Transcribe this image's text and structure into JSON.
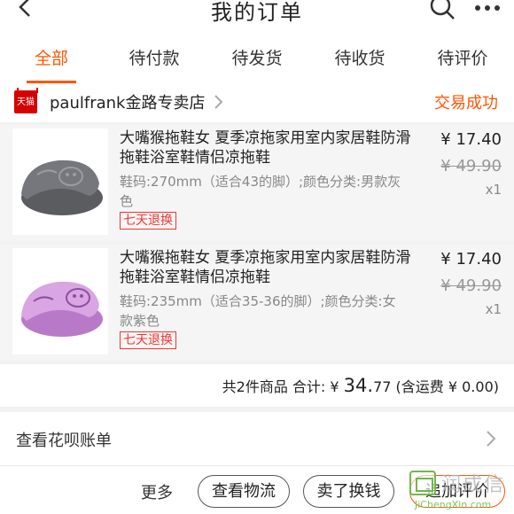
{
  "header": {
    "title": "我的订单",
    "back_icon": "chevron-left-icon",
    "search_icon": "search-icon",
    "more_icon": "more-dots-icon"
  },
  "tabs": [
    {
      "label": "全部",
      "active": true
    },
    {
      "label": "待付款",
      "active": false
    },
    {
      "label": "待发货",
      "active": false
    },
    {
      "label": "待收货",
      "active": false
    },
    {
      "label": "待评价",
      "active": false
    }
  ],
  "shop": {
    "badge": "天猫",
    "name": "paulfrank金路专卖店",
    "status": "交易成功"
  },
  "items": [
    {
      "title": "大嘴猴拖鞋女 夏季凉拖家用室内家居鞋防滑拖鞋浴室鞋情侣凉拖鞋",
      "sku": "鞋码:270mm（适合43的脚）;颜色分类:男款灰色",
      "tag": "七天退换",
      "price": "¥ 17.40",
      "original_price": "¥ 49.90",
      "quantity": "x1",
      "color": "#6d6f74"
    },
    {
      "title": "大嘴猴拖鞋女 夏季凉拖家用室内家居鞋防滑拖鞋浴室鞋情侣凉拖鞋",
      "sku": "鞋码:235mm（适合35-36的脚）;颜色分类:女款紫色",
      "tag": "七天退换",
      "price": "¥ 17.40",
      "original_price": "¥ 49.90",
      "quantity": "x1",
      "color": "#c98ad6"
    }
  ],
  "summary": {
    "prefix": "共2件商品 合计: ¥ ",
    "total_int": "34.",
    "total_dec": "77",
    "suffix": " (含运费 ¥ 0.00)"
  },
  "bill": {
    "label": "查看花呗账单"
  },
  "actions": {
    "more": "更多",
    "logistics": "查看物流",
    "sell": "卖了换钱",
    "review": "追加评价"
  },
  "watermark": {
    "text": "润成信",
    "domain": "JiChengXin.com"
  },
  "colors": {
    "accent": "#ff5500",
    "tag_red": "#e53935"
  }
}
